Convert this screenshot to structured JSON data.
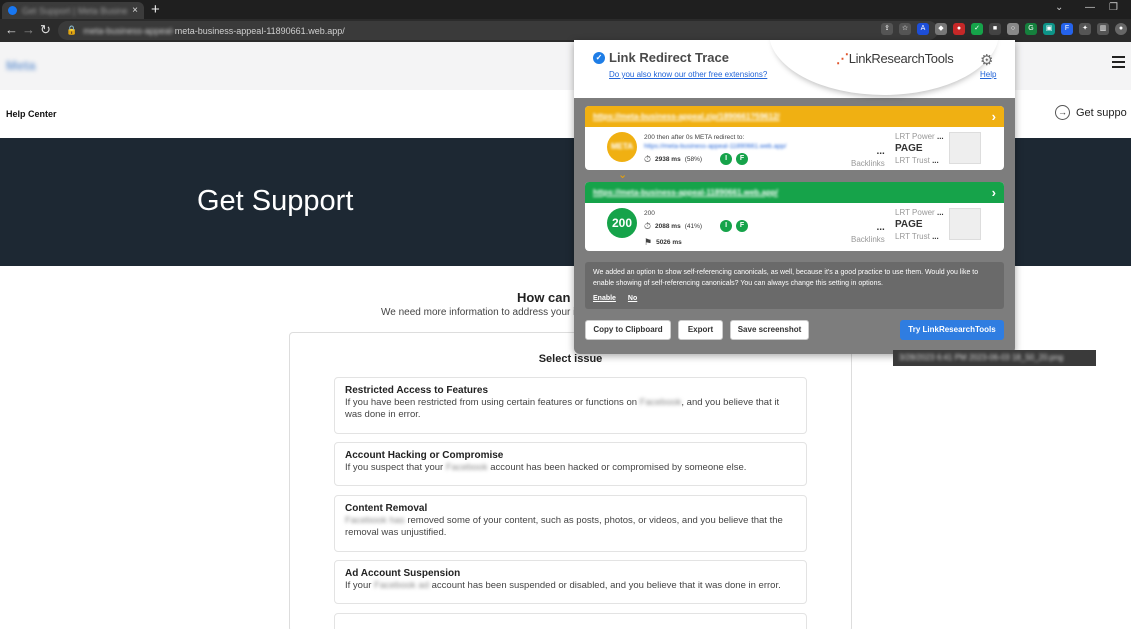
{
  "browser": {
    "tab_title": "Get Support | Meta Business Help Centre",
    "tab_close": "×",
    "new_tab": "+",
    "url_prefix": "meta-business-appeal-",
    "url_main": "meta-business-appeal-11890661.web.app/"
  },
  "site": {
    "logo_text": "Meta",
    "help_center": "Help Center",
    "get_support_link": "Get suppo",
    "hero_title": "Get Support",
    "question": "How can w",
    "subtitle": "We need more information to address your is"
  },
  "issues": {
    "heading": "Select issue",
    "items": [
      {
        "title": "Restricted Access to Features",
        "desc_a": "If you have been restricted from using certain features or functions on",
        "blur": "Facebook",
        "desc_b": ", and you believe that it was done in error."
      },
      {
        "title": "Account Hacking or Compromise",
        "desc_a": "If you suspect that your",
        "blur": "Facebook",
        "desc_b": "account has been hacked or compromised by someone else."
      },
      {
        "title": "Content Removal",
        "desc_a": "",
        "blur": "Facebook has",
        "desc_b": "removed some of your content, such as posts, photos, or videos, and you believe that the removal was unjustified."
      },
      {
        "title": "Ad Account Suspension",
        "desc_a": "If your",
        "blur": "Facebook ad",
        "desc_b": "account has been suspended or disabled, and you believe that it was done in error."
      }
    ]
  },
  "extension": {
    "title": "Link Redirect Trace",
    "other_ext_link": "Do you also know our other free extensions?",
    "logo": "LinkResearchTools",
    "help": "Help",
    "hops": [
      {
        "url": "https://meta-business-appeal.zip/1890661?59612/",
        "status": "META",
        "info_line": "200 then after 0s META redirect to:",
        "target": "https://meta-business-appeal-11890661.web.app/",
        "time": "2938 ms",
        "pct": "(58%)",
        "color": "#f0b012"
      },
      {
        "url": "https://meta-business-appeal-11890661.web.app/",
        "status": "200",
        "info_line": "200",
        "time": "2088 ms",
        "pct": "(41%)",
        "total": "5026 ms",
        "color": "#16a34a"
      }
    ],
    "metrics": {
      "power_label": "LRT Power",
      "trust_label": "LRT Trust",
      "backlinks_label": "Backlinks",
      "page_label": "PAGE",
      "dash": "...",
      "dash_short": "..."
    },
    "badges": {
      "i": "I",
      "f": "F"
    },
    "notice_text": "We added an option to show self-referencing canonicals, as well, because it's a good practice to use them. Would you like to enable showing of self-referencing canonicals? You can always change this setting in options.",
    "notice_enable": "Enable",
    "notice_no": "No",
    "buttons": {
      "copy": "Copy to Clipboard",
      "export": "Export",
      "save": "Save screenshot",
      "try": "Try LinkResearchTools"
    },
    "screenshot_tooltip": "3/28/2023 6:41 PM 2023-06-03 18_50_20.png"
  }
}
